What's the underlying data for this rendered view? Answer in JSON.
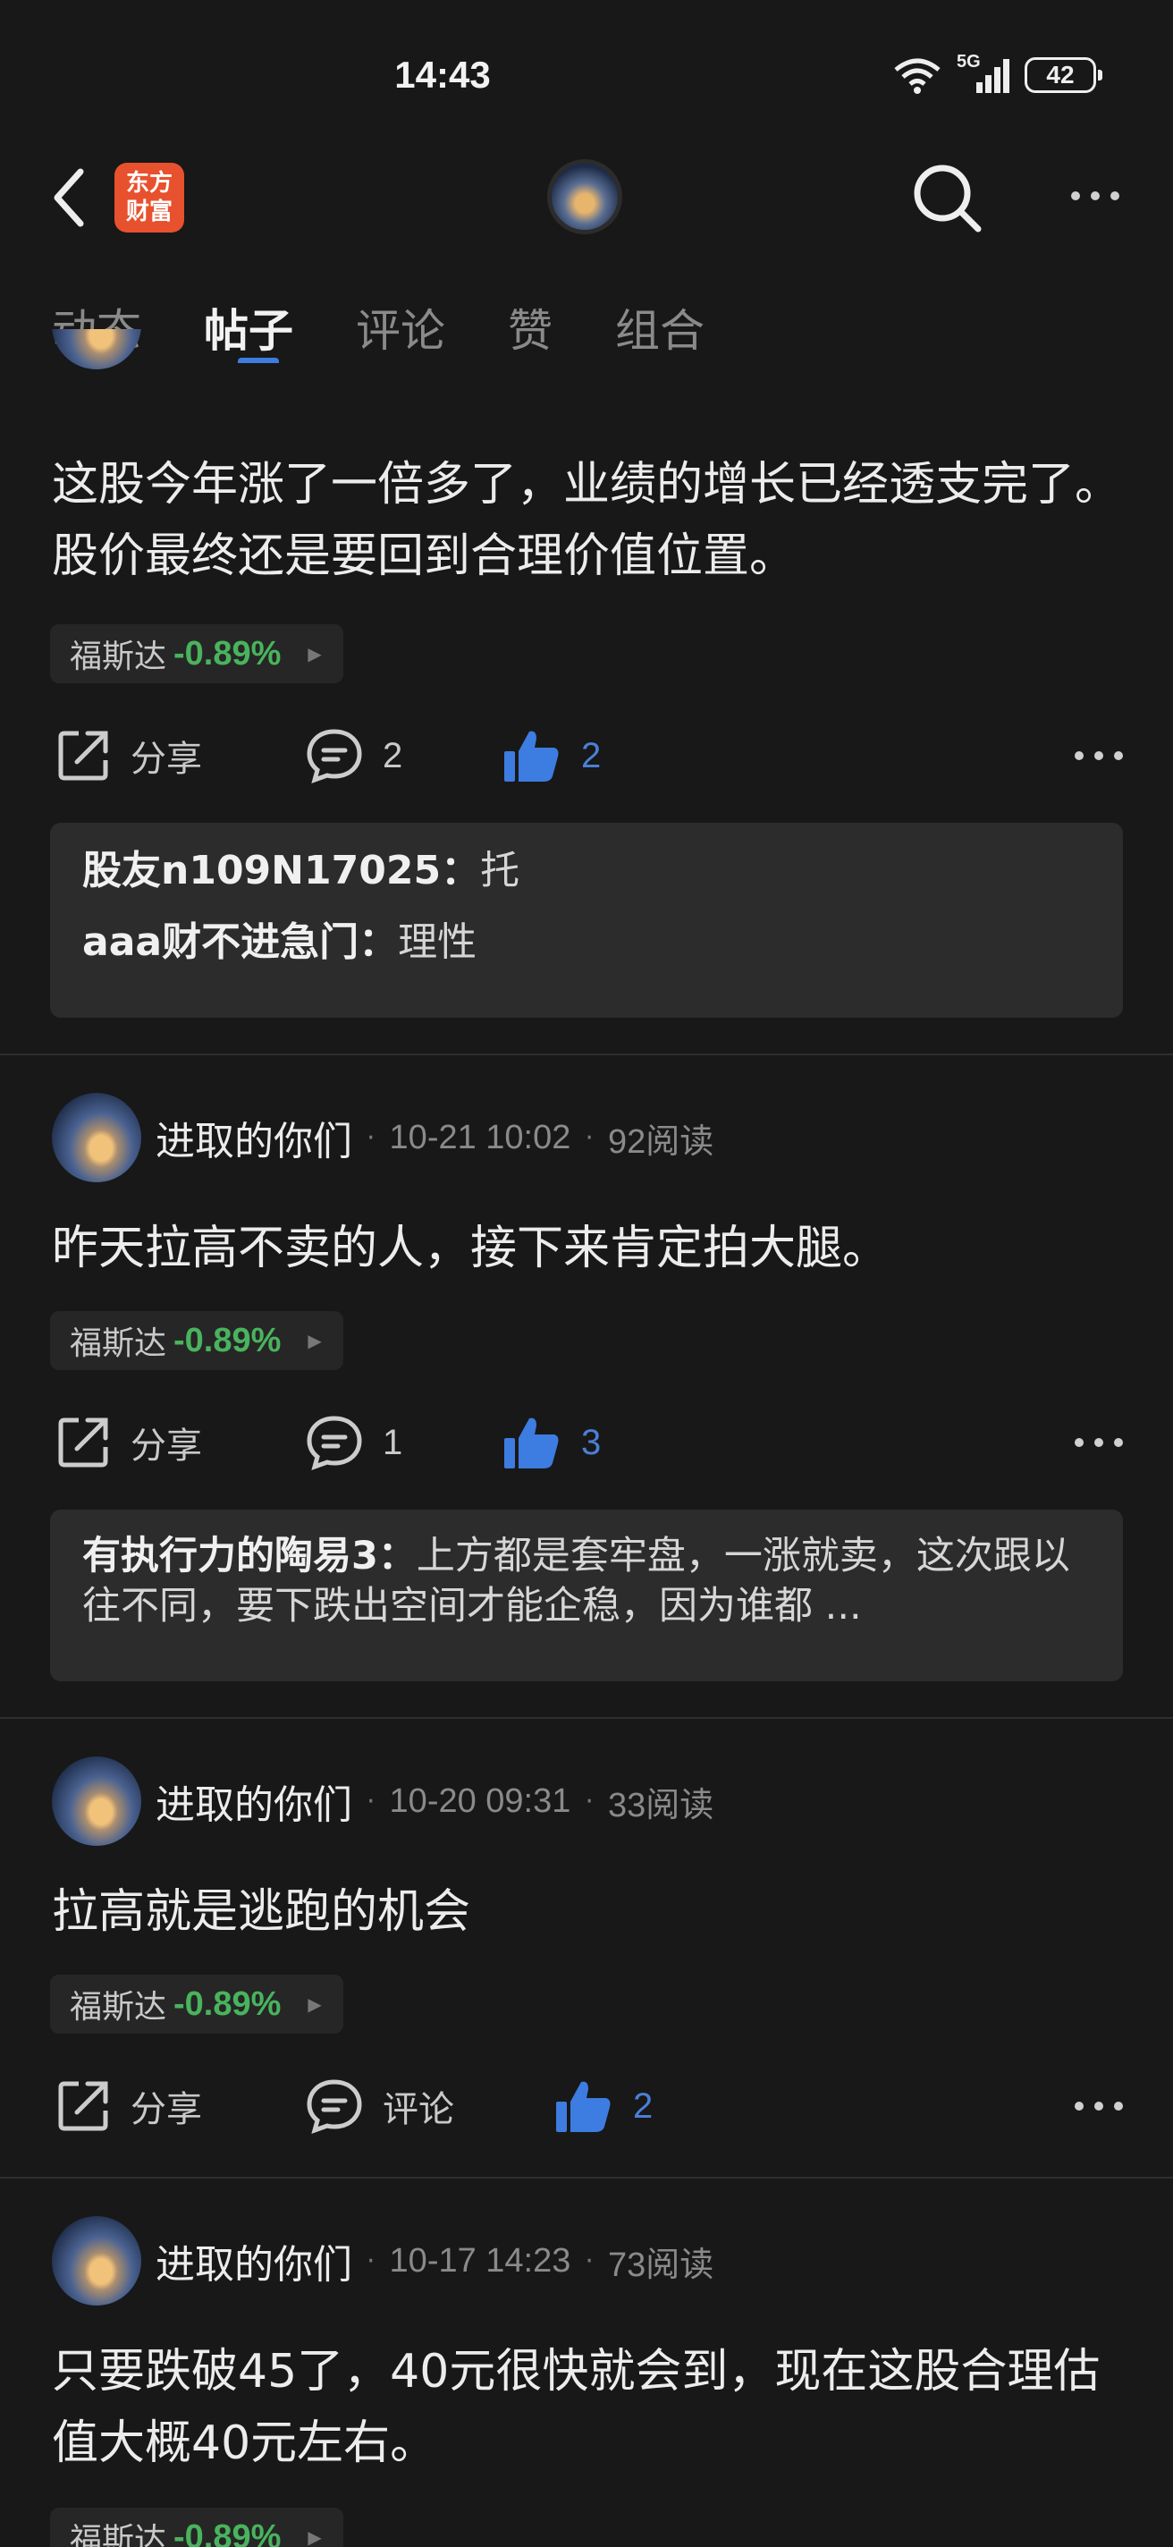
{
  "status": {
    "time": "14:43",
    "battery": "42",
    "network": "5G"
  },
  "header": {
    "logo_line1": "东方",
    "logo_line2": "财富"
  },
  "tabs": [
    {
      "label": "动态"
    },
    {
      "label": "帖子"
    },
    {
      "label": "评论"
    },
    {
      "label": "赞"
    },
    {
      "label": "组合"
    }
  ],
  "actions": {
    "share": "分享",
    "comment": "评论"
  },
  "stock": {
    "name": "福斯达",
    "change": "-0.89%"
  },
  "posts": [
    {
      "text": "这股今年涨了一倍多了，业绩的增长已经透支完了。股价最终还是要回到合理价值位置。",
      "comments": "2",
      "likes": "2",
      "replies": [
        {
          "user": "股友n109N17025：",
          "text": "托"
        },
        {
          "user": "aaa财不进急门：",
          "text": "理性"
        }
      ]
    },
    {
      "author": "进取的你们",
      "date": "10-21 10:02",
      "reads": "92阅读",
      "text": "昨天拉高不卖的人，接下来肯定拍大腿。",
      "comments": "1",
      "likes": "3",
      "replies": [
        {
          "user": "有执行力的陶易3：",
          "text": "上方都是套牢盘，一涨就卖，这次跟以往不同，要下跌出空间才能企稳，因为谁都 ..."
        }
      ]
    },
    {
      "author": "进取的你们",
      "date": "10-20 09:31",
      "reads": "33阅读",
      "text": "拉高就是逃跑的机会",
      "likes": "2"
    },
    {
      "author": "进取的你们",
      "date": "10-17 14:23",
      "reads": "73阅读",
      "text": "只要跌破45了，40元很快就会到，现在这股合理估值大概40元左右。"
    }
  ]
}
